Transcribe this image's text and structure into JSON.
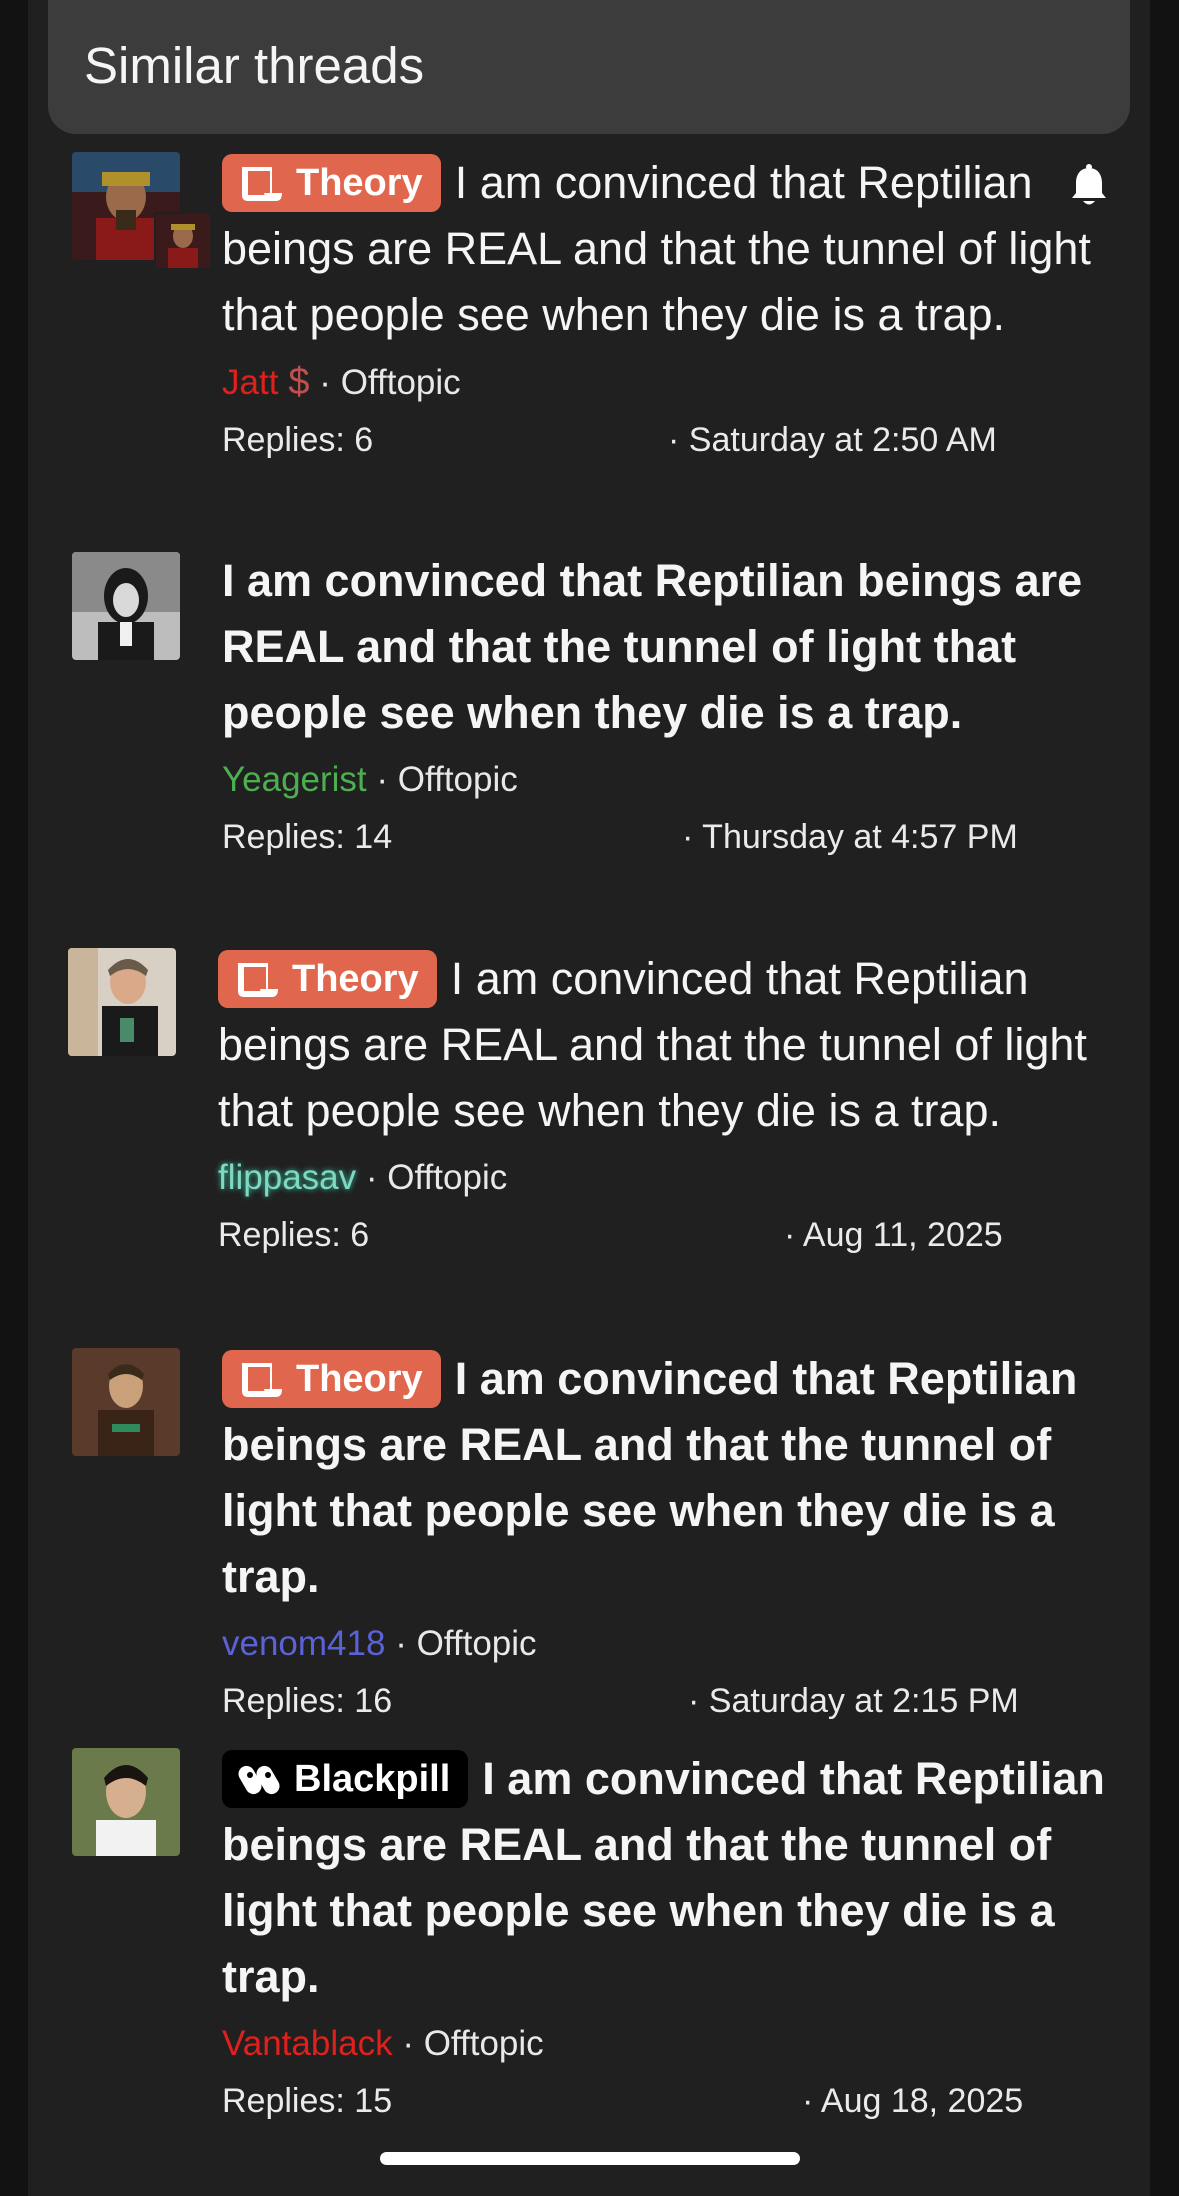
{
  "header": {
    "title": "Similar threads"
  },
  "threads": [
    {
      "prefix": "Theory",
      "title": "I am convinced that Reptilian beings are REAL and that the tunnel of light that people see when they die is a trap.",
      "author": "Jatt",
      "forum": "Offtopic",
      "replies": "Replies: 6",
      "date": "Saturday at 2:50 AM"
    },
    {
      "prefix": "",
      "title": "I am convinced that Reptilian beings are REAL and that the tunnel of light that people see when they die is a trap.",
      "author": "Yeagerist",
      "forum": "Offtopic",
      "replies": "Replies: 14",
      "date": "Thursday at 4:57 PM"
    },
    {
      "prefix": "Theory",
      "title": "I am convinced that Reptilian beings are REAL and that the tunnel of light that people see when they die is a trap.",
      "author": "flippasav",
      "forum": "Offtopic",
      "replies": "Replies: 6",
      "date": "Aug 11, 2025"
    },
    {
      "prefix": "Theory",
      "title": "I am convinced that Reptilian beings are REAL and that the tunnel of light that people see when they die is a trap.",
      "author": "venom418",
      "forum": "Offtopic",
      "replies": "Replies: 16",
      "date": "Saturday at 2:15 PM"
    },
    {
      "prefix": "Blackpill",
      "title": "I am convinced that Reptilian beings are REAL and that the tunnel of light that people see when they die is a trap.",
      "author": "Vantablack",
      "forum": "Offtopic",
      "replies": "Replies: 15",
      "date": "Aug 18, 2025"
    }
  ],
  "separator": "·",
  "user_badge_symbol": "$",
  "colors": {
    "background": "#202020",
    "header": "#3c3c3c",
    "theory_prefix": "#e0674d",
    "blackpill_prefix": "#000000"
  }
}
